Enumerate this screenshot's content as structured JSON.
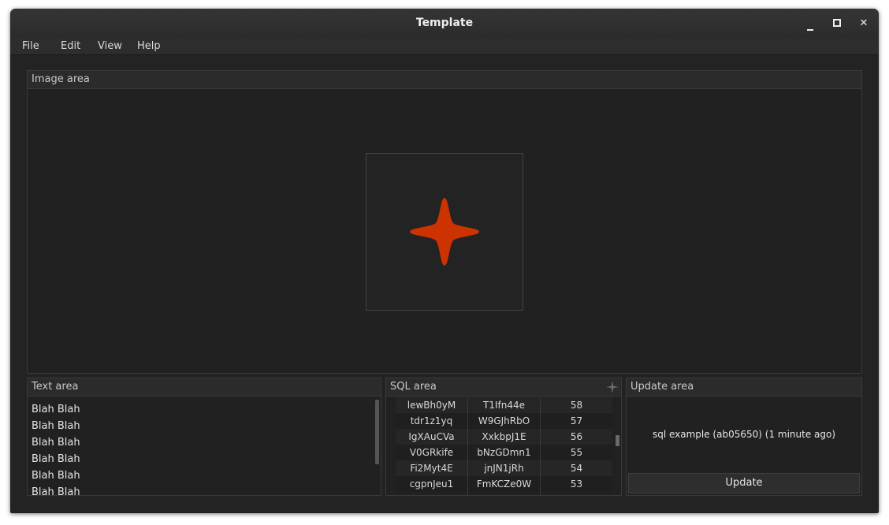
{
  "window": {
    "title": "Template",
    "controls": {
      "minimize": "minimize-icon",
      "maximize": "maximize-icon",
      "close": "close-icon"
    }
  },
  "menu": [
    "File",
    "Edit",
    "View",
    "Help"
  ],
  "image_area": {
    "title": "Image area",
    "icon": "red-four-point-star-icon",
    "icon_color": "#cc3300"
  },
  "text_area": {
    "title": "Text area",
    "lines": [
      "Blah Blah",
      "Blah Blah",
      "Blah Blah",
      "Blah Blah",
      "Blah Blah",
      "Blah Blah"
    ]
  },
  "sql_area": {
    "title": "SQL area",
    "rows": [
      [
        "lewBh0yM",
        "T1Ifn44e",
        "58"
      ],
      [
        "tdr1z1yq",
        "W9GJhRbO",
        "57"
      ],
      [
        "IgXAuCVa",
        "XxkbpJ1E",
        "56"
      ],
      [
        "V0GRkife",
        "bNzGDmn1",
        "55"
      ],
      [
        "Fi2Myt4E",
        "jnJN1jRh",
        "54"
      ],
      [
        "cgpnJeu1",
        "FmKCZe0W",
        "53"
      ]
    ]
  },
  "update_area": {
    "title": "Update area",
    "status": "sql example (ab05650) (1 minute ago)",
    "button_label": "Update"
  }
}
